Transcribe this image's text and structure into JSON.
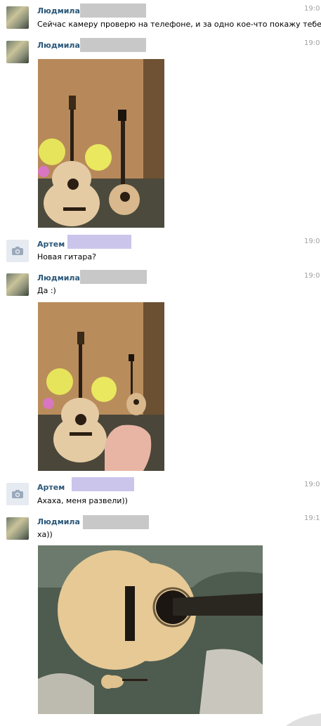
{
  "messages": [
    {
      "sender": "Людмила",
      "time": "19:0",
      "text": "Сейчас камеру проверю на телефоне, и за одно кое-что покажу тебе."
    },
    {
      "sender": "Людмила",
      "time": "19:0"
    },
    {
      "sender": "Артем",
      "time": "19:0",
      "text": "Новая гитара?"
    },
    {
      "sender": "Людмила",
      "time": "19:0",
      "text": "Да :)"
    },
    {
      "sender": "Артем",
      "time": "19:0",
      "text": "Ахаха, меня развели))"
    },
    {
      "sender": "Людмила",
      "time": "19:1",
      "text": "ха))"
    }
  ],
  "icons": {
    "default_avatar": "camera-icon"
  },
  "colors": {
    "sender_name": "#2b587a",
    "timestamp": "#a0a0a0",
    "redaction_gray": "#c8c8c8",
    "redaction_lavender": "#cbc5ec"
  }
}
